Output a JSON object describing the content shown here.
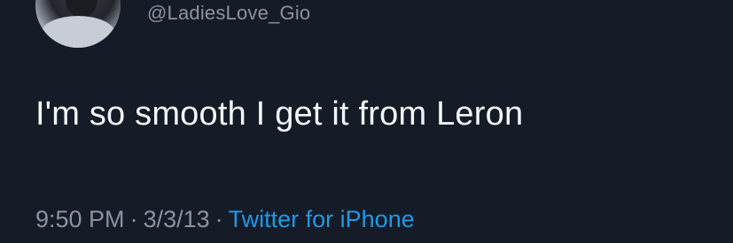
{
  "tweet": {
    "handle": "@LadiesLove_Gio",
    "text": "I'm so smooth I get it from Leron",
    "time": "9:50 PM",
    "separator": "·",
    "date": "3/3/13",
    "source": "Twitter for iPhone"
  },
  "colors": {
    "background": "#151c28",
    "text": "#f4f6f8",
    "muted": "#8a93a0",
    "link": "#1e98e8"
  }
}
